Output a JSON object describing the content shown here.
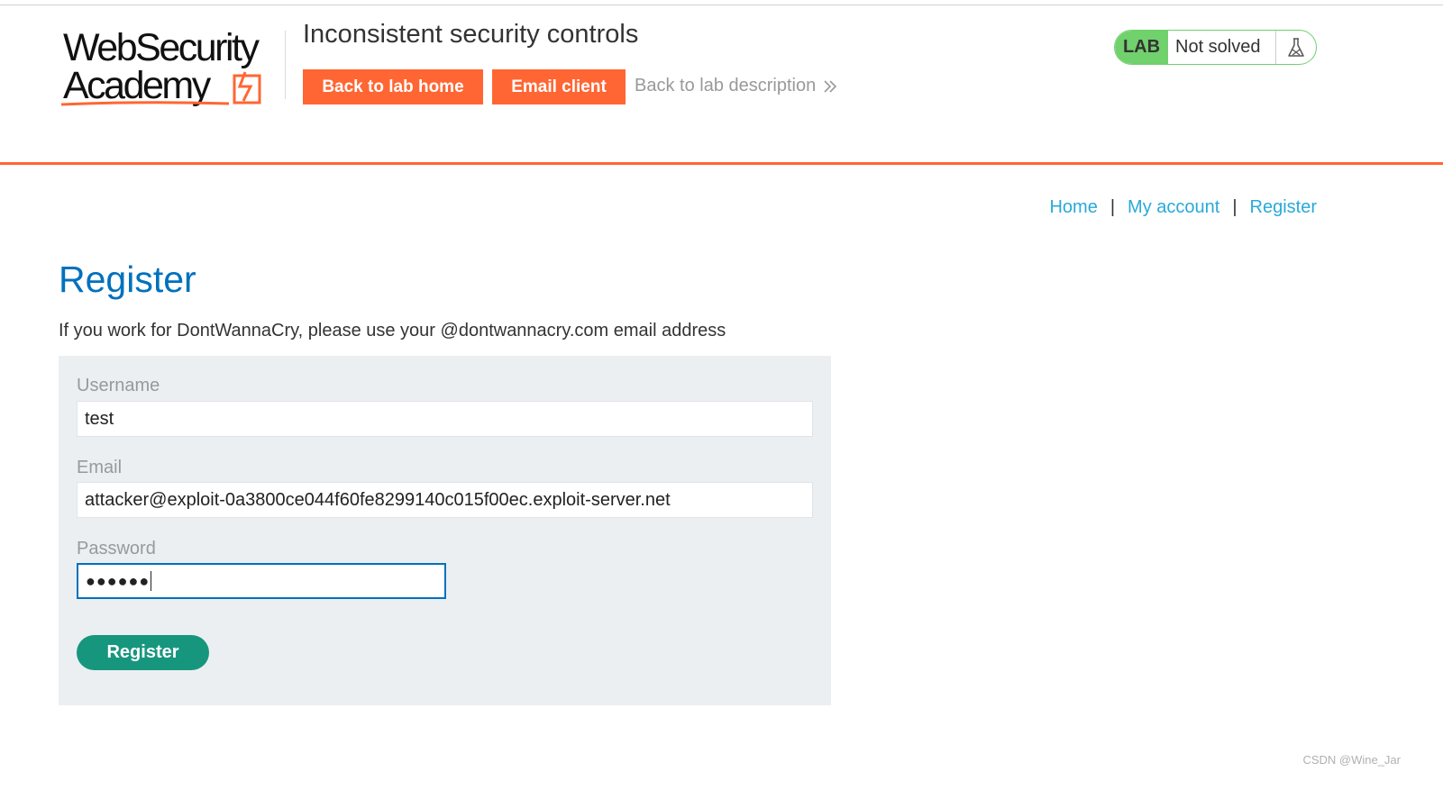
{
  "logo": {
    "line1": "WebSecurity",
    "line2": "Academy"
  },
  "header": {
    "lab_title": "Inconsistent security controls",
    "back_to_lab_home": "Back to lab home",
    "email_client": "Email client",
    "back_to_description": "Back to lab description",
    "back_to_description_icon": "double-chevron-right-icon"
  },
  "lab_status": {
    "badge": "LAB",
    "state": "Not solved",
    "icon": "flask-icon"
  },
  "nav": {
    "home": "Home",
    "my_account": "My account",
    "register": "Register",
    "separator": "|"
  },
  "main": {
    "heading": "Register",
    "intro": "If you work for DontWannaCry, please use your @dontwannacry.com email address"
  },
  "form": {
    "username_label": "Username",
    "username_value": "test",
    "email_label": "Email",
    "email_value": "attacker@exploit-0a3800ce044f60fe8299140c015f00ec.exploit-server.net",
    "password_label": "Password",
    "password_value": "●●●●●●",
    "submit_label": "Register"
  },
  "watermark": "CSDN @Wine_Jar",
  "colors": {
    "accent_orange": "#ff6633",
    "link_blue": "#29a9d8",
    "heading_blue": "#0071bc",
    "lab_green": "#70d16d",
    "button_green": "#17967e",
    "panel_bg": "#ebeff2"
  }
}
